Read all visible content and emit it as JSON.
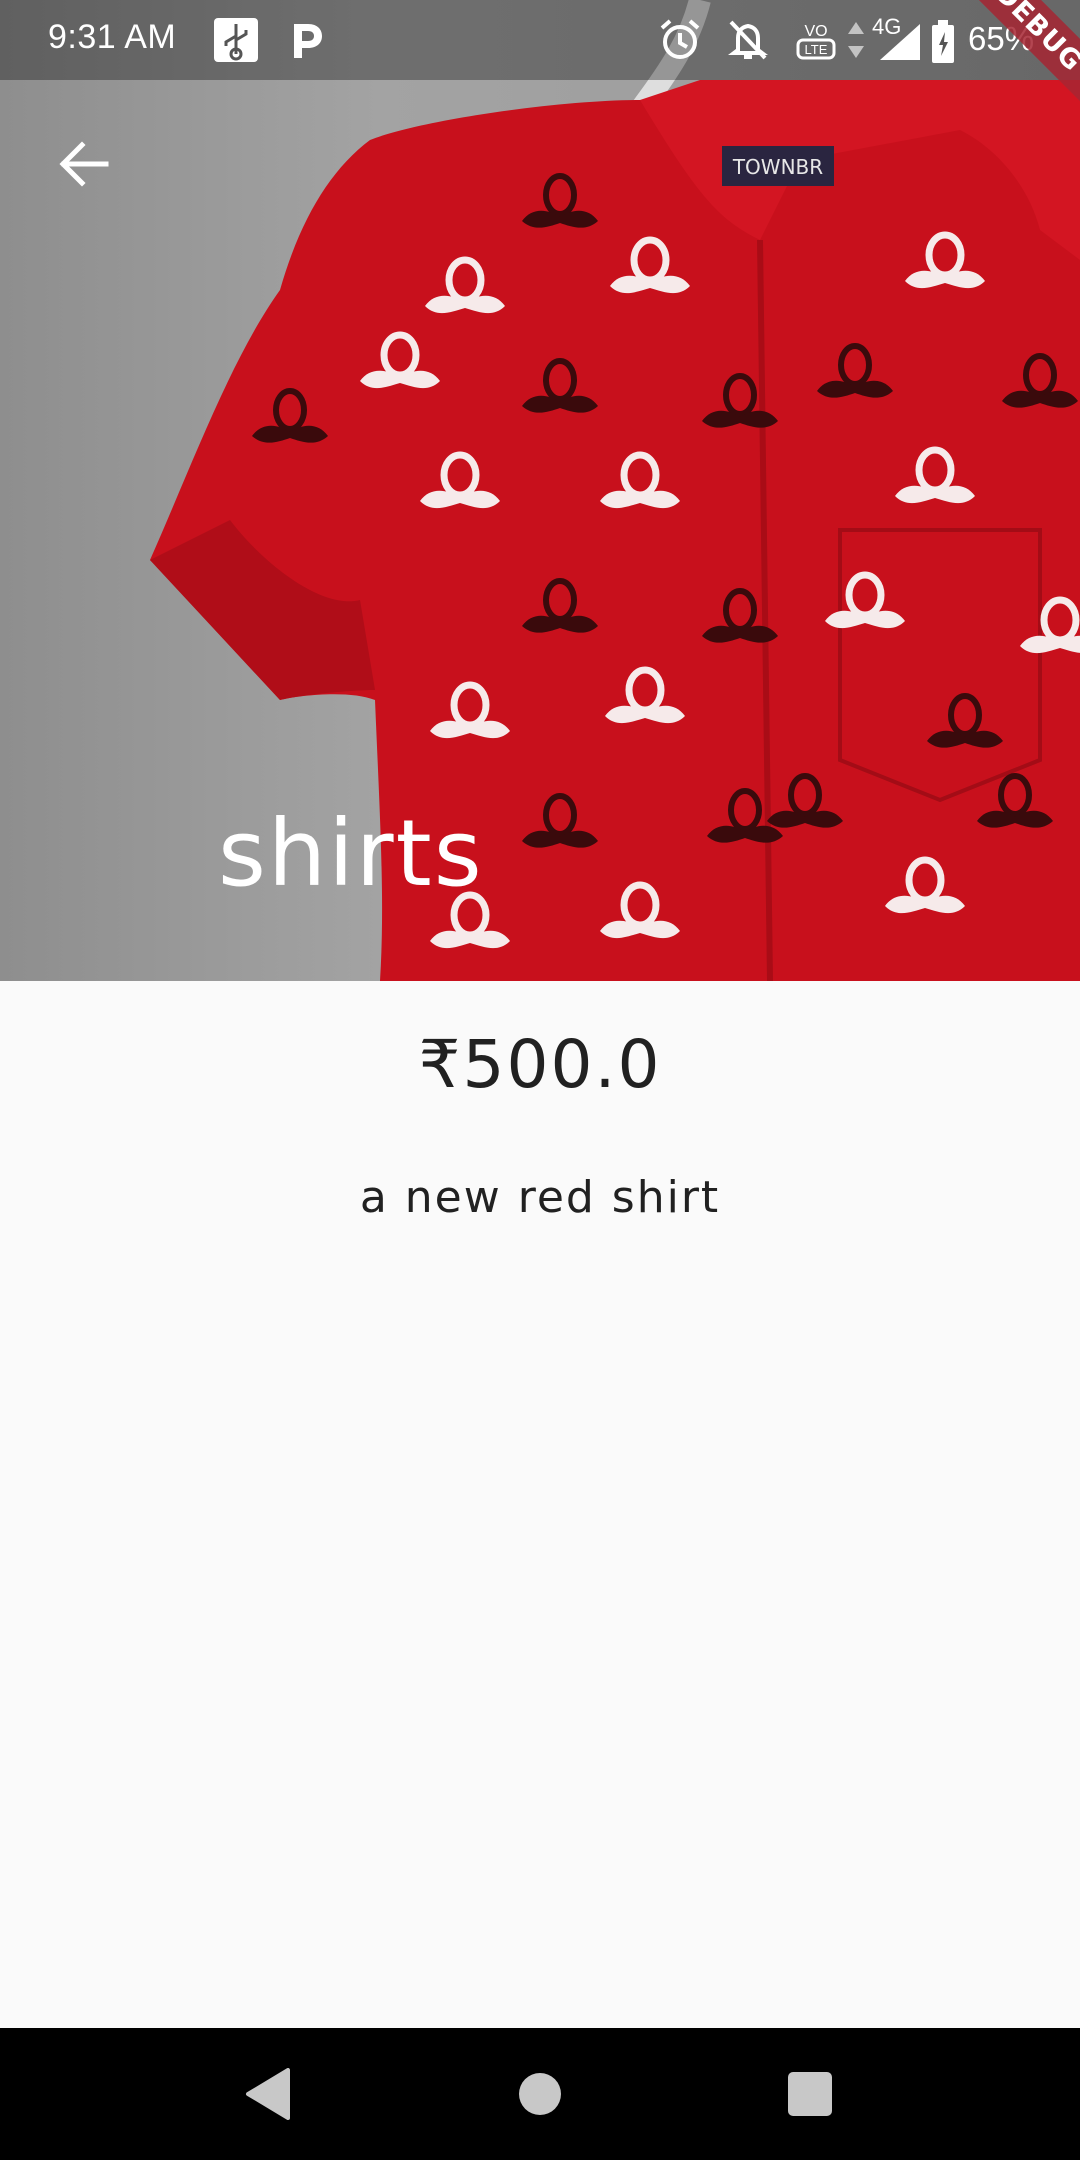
{
  "status_bar": {
    "time": "9:31 AM",
    "network": "4G",
    "battery": "65%",
    "debug_banner": "DEBUG",
    "icons": [
      "usb-icon",
      "parking-icon",
      "alarm-icon",
      "notifications-off-icon",
      "volte-icon",
      "data-arrows-icon",
      "signal-icon",
      "battery-icon"
    ]
  },
  "hero": {
    "title": "shirts",
    "brand_label": "TOWNBR",
    "back_icon": "arrow-back-icon"
  },
  "product": {
    "price": "₹500.0",
    "description": "a new red shirt"
  },
  "nav_bar": {
    "icons": [
      "back-triangle-icon",
      "home-circle-icon",
      "recents-square-icon"
    ]
  },
  "colors": {
    "shirt_red": "#c8101c",
    "background": "#fafafa",
    "text": "#212121",
    "nav_bar": "#000000"
  }
}
